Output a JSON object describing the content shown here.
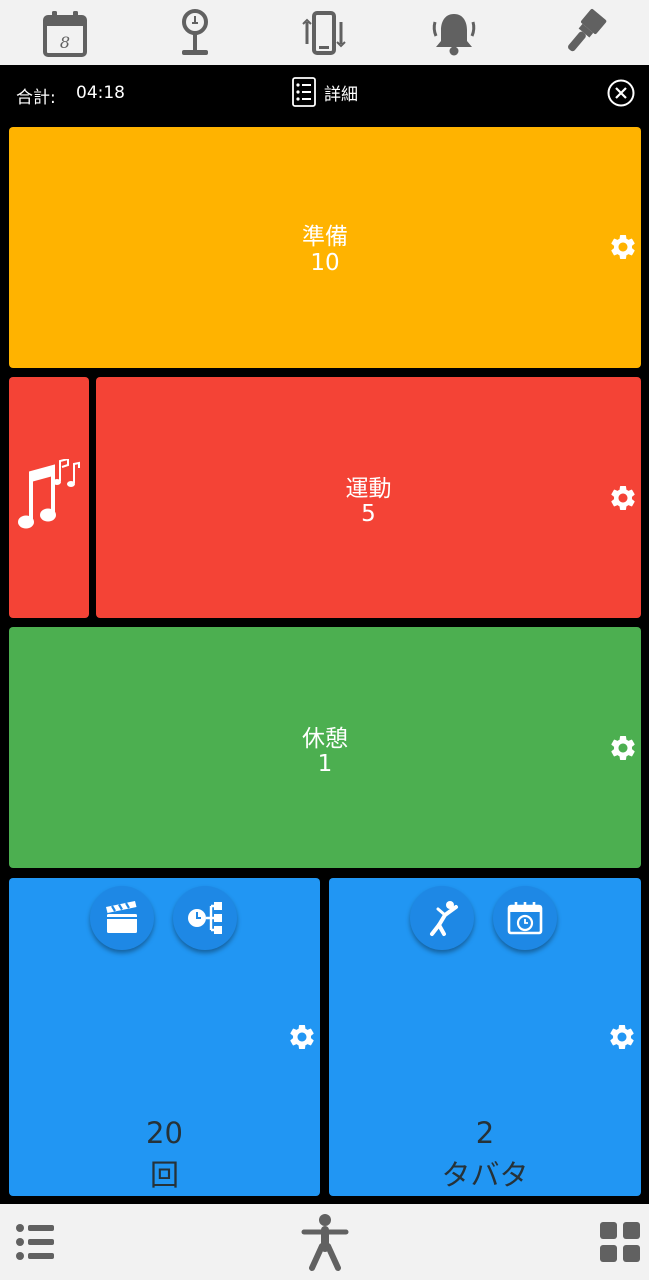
{
  "toolbar": {
    "icons": [
      "calendar-icon",
      "scale-icon",
      "phone-rotate-icon",
      "bell-icon",
      "paintbrush-icon"
    ],
    "calendar_day": "8"
  },
  "header": {
    "total_label": "合計:",
    "total_value": "04:18",
    "detail_label": "詳細"
  },
  "panels": {
    "prep": {
      "label": "準備",
      "value": "10",
      "color": "#ffb300"
    },
    "exercise": {
      "label": "運動",
      "value": "5",
      "color": "#f44336"
    },
    "rest": {
      "label": "休憩",
      "value": "1",
      "color": "#4caf50"
    },
    "rounds": {
      "value": "20",
      "unit": "回",
      "color": "#2196f3"
    },
    "tabata": {
      "value": "2",
      "unit": "タバタ",
      "color": "#2196f3"
    }
  },
  "bottom_bar": {
    "icons": [
      "list-icon",
      "exercise-figure-icon",
      "grid-icon"
    ]
  }
}
